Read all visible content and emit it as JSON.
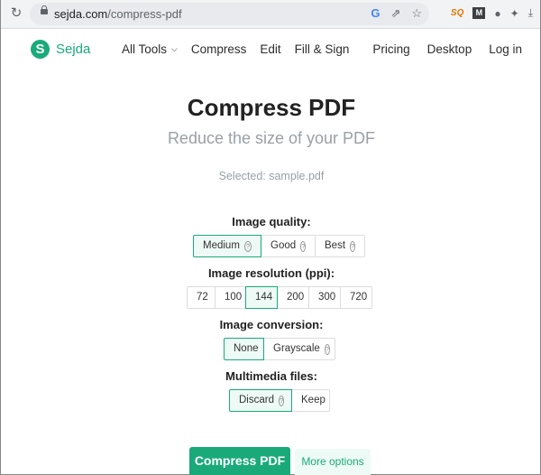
{
  "browser": {
    "url_host": "sejda.com",
    "url_path": "/compress-pdf",
    "icons": [
      "reload-icon",
      "lock-icon",
      "google-icon",
      "share-icon",
      "star-icon",
      "extension-sq-icon",
      "extension-m-icon",
      "extension-circles-icon",
      "puzzle-icon",
      "download-icon"
    ]
  },
  "nav": {
    "logo_letter": "S",
    "logo_text": "Sejda",
    "left_items": [
      "All Tools",
      "Compress",
      "Edit",
      "Fill & Sign"
    ],
    "right_items": [
      "Pricing",
      "Desktop",
      "Log in"
    ]
  },
  "main": {
    "title": "Compress PDF",
    "subtitle": "Reduce the size of your PDF",
    "selected": "Selected: sample.pdf",
    "image_quality": {
      "label": "Image quality:",
      "options": [
        "Medium",
        "Good",
        "Best"
      ],
      "selected": "Medium"
    },
    "image_resolution": {
      "label": "Image resolution (ppi):",
      "options": [
        "72",
        "100",
        "144",
        "200",
        "300",
        "720"
      ],
      "selected": "144"
    },
    "image_conversion": {
      "label": "Image conversion:",
      "options": [
        "None",
        "Grayscale"
      ],
      "selected": "None"
    },
    "multimedia": {
      "label": "Multimedia files:",
      "options": [
        "Discard",
        "Keep"
      ],
      "selected": "Discard"
    },
    "compress_button": "Compress PDF",
    "more_options_button": "More options"
  },
  "colors": {
    "brand": "#1aaa7a",
    "active_bg": "#eefaf6"
  }
}
